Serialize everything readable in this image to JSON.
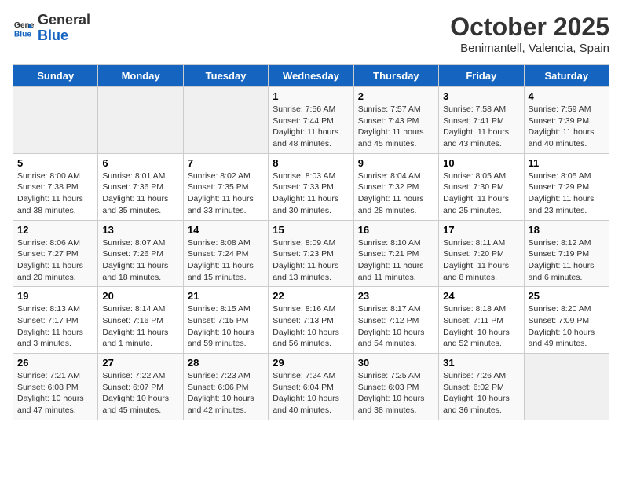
{
  "header": {
    "logo_line1": "General",
    "logo_line2": "Blue",
    "month": "October 2025",
    "location": "Benimantell, Valencia, Spain"
  },
  "weekdays": [
    "Sunday",
    "Monday",
    "Tuesday",
    "Wednesday",
    "Thursday",
    "Friday",
    "Saturday"
  ],
  "weeks": [
    [
      {
        "day": "",
        "info": ""
      },
      {
        "day": "",
        "info": ""
      },
      {
        "day": "",
        "info": ""
      },
      {
        "day": "1",
        "info": "Sunrise: 7:56 AM\nSunset: 7:44 PM\nDaylight: 11 hours\nand 48 minutes."
      },
      {
        "day": "2",
        "info": "Sunrise: 7:57 AM\nSunset: 7:43 PM\nDaylight: 11 hours\nand 45 minutes."
      },
      {
        "day": "3",
        "info": "Sunrise: 7:58 AM\nSunset: 7:41 PM\nDaylight: 11 hours\nand 43 minutes."
      },
      {
        "day": "4",
        "info": "Sunrise: 7:59 AM\nSunset: 7:39 PM\nDaylight: 11 hours\nand 40 minutes."
      }
    ],
    [
      {
        "day": "5",
        "info": "Sunrise: 8:00 AM\nSunset: 7:38 PM\nDaylight: 11 hours\nand 38 minutes."
      },
      {
        "day": "6",
        "info": "Sunrise: 8:01 AM\nSunset: 7:36 PM\nDaylight: 11 hours\nand 35 minutes."
      },
      {
        "day": "7",
        "info": "Sunrise: 8:02 AM\nSunset: 7:35 PM\nDaylight: 11 hours\nand 33 minutes."
      },
      {
        "day": "8",
        "info": "Sunrise: 8:03 AM\nSunset: 7:33 PM\nDaylight: 11 hours\nand 30 minutes."
      },
      {
        "day": "9",
        "info": "Sunrise: 8:04 AM\nSunset: 7:32 PM\nDaylight: 11 hours\nand 28 minutes."
      },
      {
        "day": "10",
        "info": "Sunrise: 8:05 AM\nSunset: 7:30 PM\nDaylight: 11 hours\nand 25 minutes."
      },
      {
        "day": "11",
        "info": "Sunrise: 8:05 AM\nSunset: 7:29 PM\nDaylight: 11 hours\nand 23 minutes."
      }
    ],
    [
      {
        "day": "12",
        "info": "Sunrise: 8:06 AM\nSunset: 7:27 PM\nDaylight: 11 hours\nand 20 minutes."
      },
      {
        "day": "13",
        "info": "Sunrise: 8:07 AM\nSunset: 7:26 PM\nDaylight: 11 hours\nand 18 minutes."
      },
      {
        "day": "14",
        "info": "Sunrise: 8:08 AM\nSunset: 7:24 PM\nDaylight: 11 hours\nand 15 minutes."
      },
      {
        "day": "15",
        "info": "Sunrise: 8:09 AM\nSunset: 7:23 PM\nDaylight: 11 hours\nand 13 minutes."
      },
      {
        "day": "16",
        "info": "Sunrise: 8:10 AM\nSunset: 7:21 PM\nDaylight: 11 hours\nand 11 minutes."
      },
      {
        "day": "17",
        "info": "Sunrise: 8:11 AM\nSunset: 7:20 PM\nDaylight: 11 hours\nand 8 minutes."
      },
      {
        "day": "18",
        "info": "Sunrise: 8:12 AM\nSunset: 7:19 PM\nDaylight: 11 hours\nand 6 minutes."
      }
    ],
    [
      {
        "day": "19",
        "info": "Sunrise: 8:13 AM\nSunset: 7:17 PM\nDaylight: 11 hours\nand 3 minutes."
      },
      {
        "day": "20",
        "info": "Sunrise: 8:14 AM\nSunset: 7:16 PM\nDaylight: 11 hours\nand 1 minute."
      },
      {
        "day": "21",
        "info": "Sunrise: 8:15 AM\nSunset: 7:15 PM\nDaylight: 10 hours\nand 59 minutes."
      },
      {
        "day": "22",
        "info": "Sunrise: 8:16 AM\nSunset: 7:13 PM\nDaylight: 10 hours\nand 56 minutes."
      },
      {
        "day": "23",
        "info": "Sunrise: 8:17 AM\nSunset: 7:12 PM\nDaylight: 10 hours\nand 54 minutes."
      },
      {
        "day": "24",
        "info": "Sunrise: 8:18 AM\nSunset: 7:11 PM\nDaylight: 10 hours\nand 52 minutes."
      },
      {
        "day": "25",
        "info": "Sunrise: 8:20 AM\nSunset: 7:09 PM\nDaylight: 10 hours\nand 49 minutes."
      }
    ],
    [
      {
        "day": "26",
        "info": "Sunrise: 7:21 AM\nSunset: 6:08 PM\nDaylight: 10 hours\nand 47 minutes."
      },
      {
        "day": "27",
        "info": "Sunrise: 7:22 AM\nSunset: 6:07 PM\nDaylight: 10 hours\nand 45 minutes."
      },
      {
        "day": "28",
        "info": "Sunrise: 7:23 AM\nSunset: 6:06 PM\nDaylight: 10 hours\nand 42 minutes."
      },
      {
        "day": "29",
        "info": "Sunrise: 7:24 AM\nSunset: 6:04 PM\nDaylight: 10 hours\nand 40 minutes."
      },
      {
        "day": "30",
        "info": "Sunrise: 7:25 AM\nSunset: 6:03 PM\nDaylight: 10 hours\nand 38 minutes."
      },
      {
        "day": "31",
        "info": "Sunrise: 7:26 AM\nSunset: 6:02 PM\nDaylight: 10 hours\nand 36 minutes."
      },
      {
        "day": "",
        "info": ""
      }
    ]
  ]
}
